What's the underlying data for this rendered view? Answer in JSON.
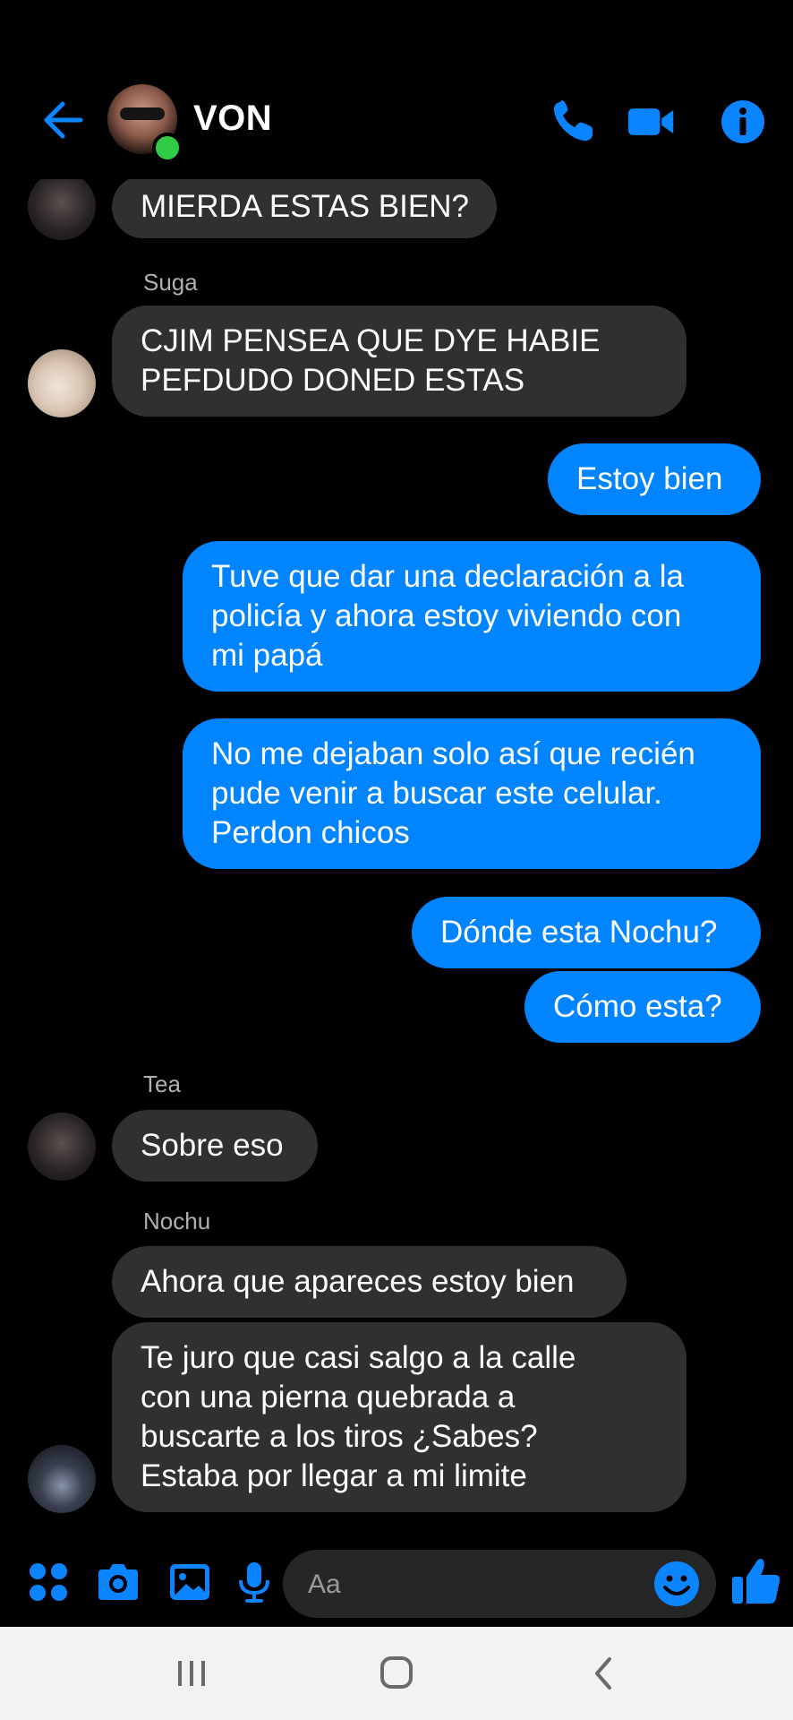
{
  "header": {
    "contact_name": "VON",
    "online": true,
    "icons": [
      "back-arrow-icon",
      "phone-icon",
      "video-camera-icon",
      "info-icon"
    ]
  },
  "messages": [
    {
      "direction": "in",
      "text_lines": [
        "MIERDA ESTAS BIEN?"
      ]
    },
    {
      "direction": "in",
      "sender": "Suga",
      "text_lines": [
        "CJIM PENSEA QUE DYE HABIE",
        "PEFDUDO DONED ESTAS"
      ]
    },
    {
      "direction": "out",
      "text_lines": [
        "Estoy bien"
      ]
    },
    {
      "direction": "out",
      "text_lines": [
        "Tuve que dar una declaración a la",
        "policía y ahora estoy viviendo con",
        "mi papá"
      ]
    },
    {
      "direction": "out",
      "text_lines": [
        "No me dejaban solo así que recién",
        "pude venir a buscar este celular.",
        "Perdon chicos"
      ]
    },
    {
      "direction": "out",
      "text_lines": [
        "Dónde esta Nochu?"
      ]
    },
    {
      "direction": "out",
      "text_lines": [
        "Cómo esta?"
      ]
    },
    {
      "direction": "in",
      "sender": "Tea",
      "text_lines": [
        "Sobre eso"
      ]
    },
    {
      "direction": "in",
      "sender": "Nochu",
      "text_lines": [
        "Ahora que apareces estoy bien"
      ]
    },
    {
      "direction": "in",
      "text_lines": [
        "Te juro que casi salgo a la calle",
        "con una pierna quebrada a",
        "buscarte a los tiros ¿Sabes?",
        "Estaba por llegar a mi limite"
      ]
    }
  ],
  "composer": {
    "placeholder": "Aa",
    "icons": [
      "apps-grid-icon",
      "camera-icon",
      "gallery-icon",
      "microphone-icon",
      "emoji-icon",
      "thumbs-up-icon"
    ]
  },
  "colors": {
    "accent": "#0084ff",
    "incoming_bubble": "#303030",
    "background": "#000000",
    "online": "#31cc46"
  },
  "system_nav": {
    "icons": [
      "recents-icon",
      "home-icon",
      "back-icon"
    ]
  }
}
